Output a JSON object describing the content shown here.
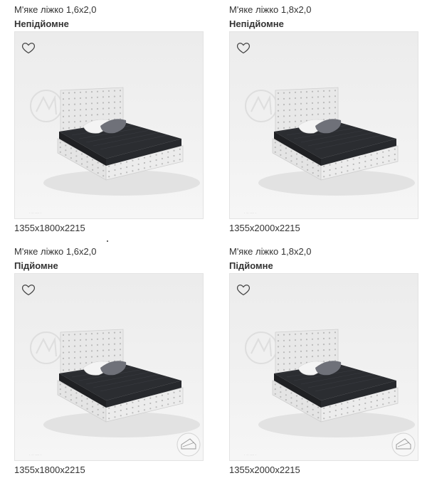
{
  "products": [
    {
      "title": "М'яке ліжко 1,6х2,0",
      "subtitle": "Непідйомне",
      "dims": "1355х1800х2215",
      "mechanism_badge": false
    },
    {
      "title": "М'яке ліжко 1,8х2,0",
      "subtitle": "Непідйомне",
      "dims": "1355х2000х2215",
      "mechanism_badge": false
    },
    {
      "title": "М'яке ліжко 1,6х2,0",
      "subtitle": "Підйомне",
      "dims": "1355х1800х2215",
      "mechanism_badge": true
    },
    {
      "title": "М'яке ліжко 1,8х2,0",
      "subtitle": "Підйомне",
      "dims": "1355х2000х2215",
      "mechanism_badge": true
    }
  ],
  "icons": {
    "favorite": "heart-outline-icon"
  },
  "colors": {
    "frame": "#e3e3e3",
    "text": "#333333",
    "bed_upholstery": "#e8e8e8",
    "mattress": "#2b2d31"
  }
}
